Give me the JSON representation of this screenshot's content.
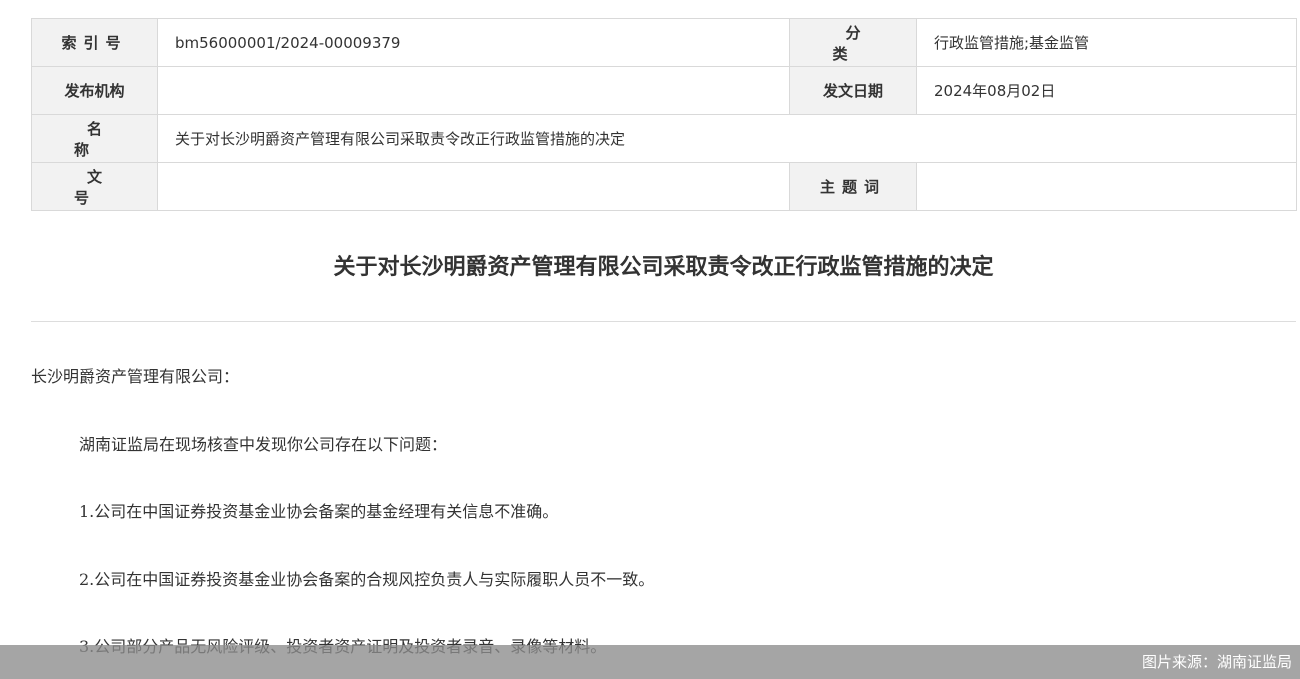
{
  "meta": {
    "index_label": "索引号",
    "index_value": "bm56000001/2024-00009379",
    "category_label": "分 类",
    "category_value": "行政监管措施;基金监管",
    "publisher_label": "发布机构",
    "publisher_value": "",
    "date_label": "发文日期",
    "date_value": "2024年08月02日",
    "name_label": "名 称",
    "name_value": "关于对长沙明爵资产管理有限公司采取责令改正行政监管措施的决定",
    "docno_label": "文 号",
    "docno_value": "",
    "subject_label": "主题词",
    "subject_value": ""
  },
  "document": {
    "title": "关于对长沙明爵资产管理有限公司采取责令改正行政监管措施的决定",
    "paragraphs": [
      "长沙明爵资产管理有限公司：",
      "湖南证监局在现场核查中发现你公司存在以下问题：",
      "1.公司在中国证券投资基金业协会备案的基金经理有关信息不准确。",
      "2.公司在中国证券投资基金业协会备案的合规风控负责人与实际履职人员不一致。",
      "3.公司部分产品无风险评级、投资者资产证明及投资者录音、录像等材料。"
    ]
  },
  "image_source": {
    "caption": "图片来源：湖南证监局"
  }
}
